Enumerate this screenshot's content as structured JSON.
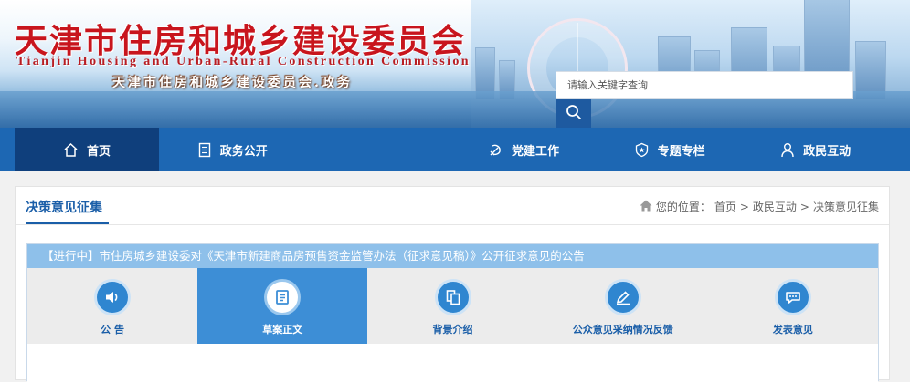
{
  "header": {
    "title_cn": "天津市住房和城乡建设委员会",
    "title_en": "Tianjin Housing and Urban-Rural Construction Commission",
    "subtitle": "天津市住房和城乡建设委员会.政务",
    "search": {
      "placeholder": "请输入关键字查询",
      "button_icon": "search-icon"
    }
  },
  "nav": {
    "items": [
      {
        "label": "首页",
        "icon": "home-icon",
        "active": true
      },
      {
        "label": "政务公开",
        "icon": "document-icon"
      },
      {
        "label": "",
        "icon": ""
      },
      {
        "label": "党建工作",
        "icon": "party-emblem-icon"
      },
      {
        "label": "专题专栏",
        "icon": "star-badge-icon"
      },
      {
        "label": "政民互动",
        "icon": "person-icon"
      }
    ]
  },
  "section": {
    "title": "决策意见征集",
    "breadcrumb": {
      "prefix": "您的位置：",
      "items": [
        "首页",
        "政民互动",
        "决策意见征集"
      ],
      "separator": ">"
    }
  },
  "notice": {
    "heading": "【进行中】市住房城乡建设委对《天津市新建商品房预售资金监管办法（征求意见稿）》公开征求意见的公告",
    "tabs": [
      {
        "label": "公  告",
        "icon": "speaker-icon"
      },
      {
        "label": "草案正文",
        "icon": "document-icon",
        "active": true
      },
      {
        "label": "背景介绍",
        "icon": "copy-icon"
      },
      {
        "label": "公众意见采纳情况反馈",
        "icon": "edit-icon"
      },
      {
        "label": "发表意见",
        "icon": "chat-icon"
      }
    ]
  },
  "colors": {
    "brand_red": "#c8151d",
    "nav_blue": "#1d67b3",
    "nav_active": "#0f3f7c",
    "accent_blue": "#1a5ea8",
    "tab_active": "#3d8ed6",
    "panel_head": "#8ec0ea"
  }
}
